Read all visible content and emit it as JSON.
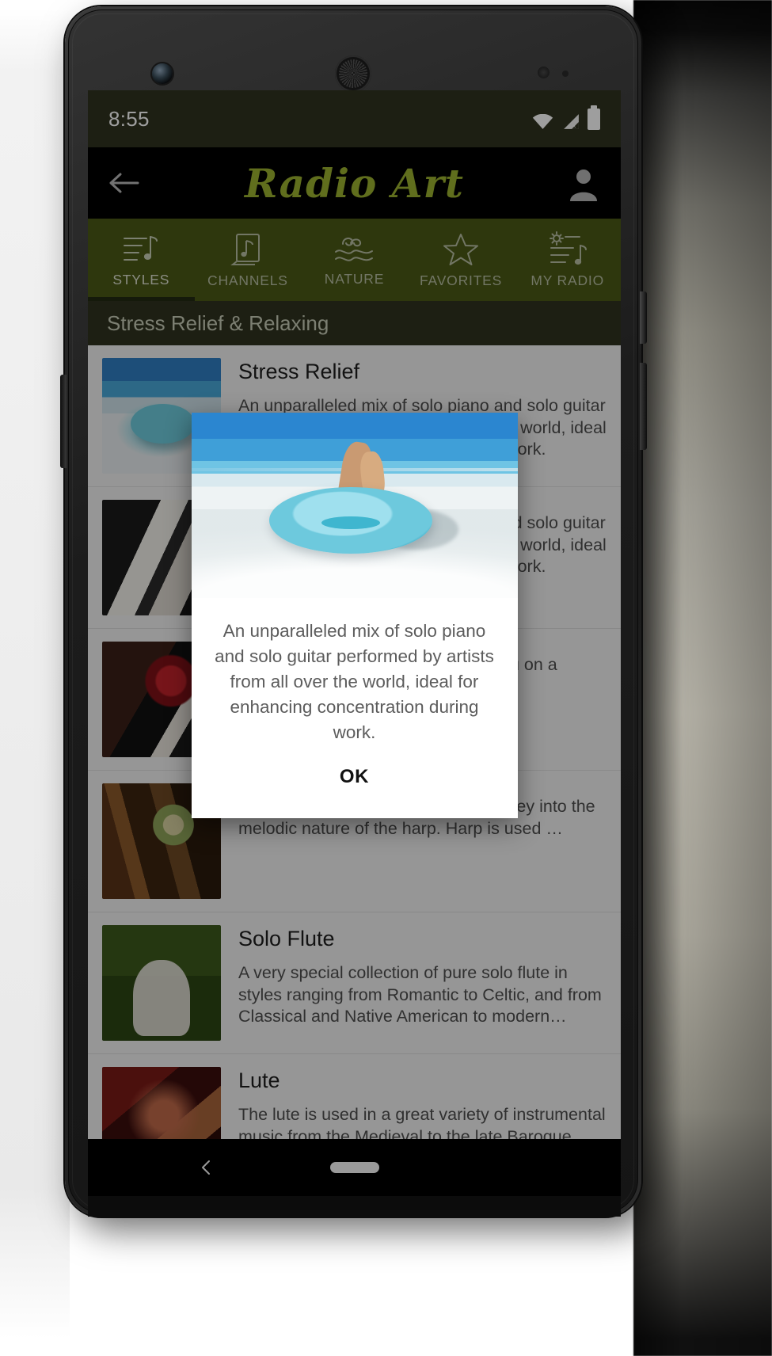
{
  "status_bar": {
    "time": "8:55",
    "icons": [
      "wifi-icon",
      "cellular-signal-icon",
      "battery-icon"
    ]
  },
  "app_bar": {
    "back_icon": "back-arrow-icon",
    "title": "Radio Art",
    "account_icon": "user-account-icon"
  },
  "tabs": [
    {
      "label": "STYLES",
      "icon": "playlist-note-icon",
      "active": true
    },
    {
      "label": "CHANNELS",
      "icon": "album-note-icon",
      "active": false
    },
    {
      "label": "NATURE",
      "icon": "waves-icon",
      "active": false
    },
    {
      "label": "FAVORITES",
      "icon": "star-outline-icon",
      "active": false
    },
    {
      "label": "MY RADIO",
      "icon": "settings-playlist-icon",
      "active": false
    }
  ],
  "section": {
    "title": "Stress Relief & Relaxing"
  },
  "list": [
    {
      "title": "Stress Relief",
      "description": "An unparalleled mix of solo piano and solo guitar performed by artists from all over the world, ideal for enhancing concentration during work.",
      "thumb": "beach-hat-photo"
    },
    {
      "title": "",
      "description": "An unparalleled mix of solo piano and solo guitar performed by artists from all over the world, ideal for enhancing concentration during work.",
      "thumb": "piano-keys-photo"
    },
    {
      "title": "",
      "description": "A broad array of music that takes you on a journey…",
      "thumb": "rose-on-piano-photo"
    },
    {
      "title": "",
      "description": "Inspire all those on a dedicated journey into the melodic nature of the harp. Harp is used …",
      "thumb": "harp-flowers-photo"
    },
    {
      "title": "Solo Flute",
      "description": "A very special collection of pure solo flute in styles ranging from Romantic to Celtic, and from Classical and Native American to modern classi…",
      "thumb": "girl-with-flute-photo"
    },
    {
      "title": "Lute",
      "description": "The lute is used in a great variety of instrumental music from the Medieval to the late Baroque eras. Soothe away stress as you are bathed in blissful",
      "thumb": "lute-player-painting"
    }
  ],
  "dialog": {
    "image": "beach-hat-photo",
    "text": "An unparalleled mix of solo piano and solo guitar performed by artists from all over the world, ideal for enhancing concentration during work.",
    "ok_label": "OK"
  },
  "nav_bar": {
    "back_icon": "nav-back-icon",
    "home_icon": "nav-home-pill-icon"
  },
  "colors": {
    "brand_green": "#9cb230",
    "tab_bar": "#4b5a16",
    "status_bar": "#2f3320",
    "app_bar": "#000000"
  }
}
